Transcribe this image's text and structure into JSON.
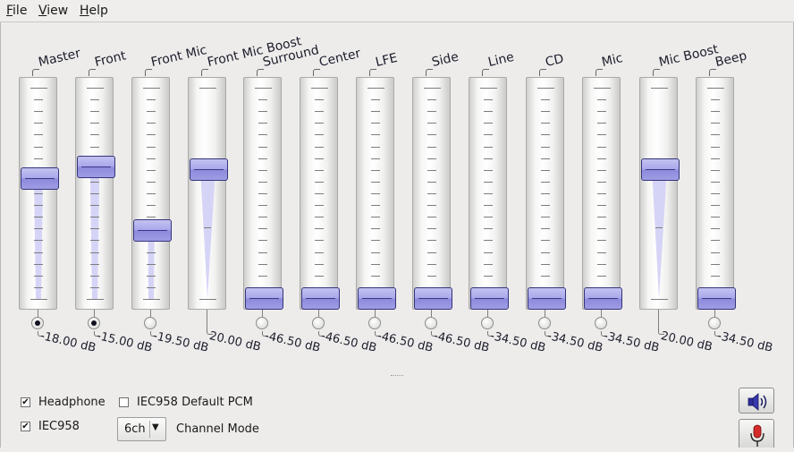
{
  "menu": [
    {
      "label": "File",
      "mnemonic": "F",
      "rest": "ile"
    },
    {
      "label": "View",
      "mnemonic": "V",
      "rest": "iew"
    },
    {
      "label": "Help",
      "mnemonic": "H",
      "rest": "elp"
    }
  ],
  "channels": [
    {
      "name": "Master",
      "volume_db": "-18.00 dB",
      "level": 0.6,
      "record": true
    },
    {
      "name": "Front",
      "volume_db": "-15.00 dB",
      "level": 0.655,
      "record": true
    },
    {
      "name": "Front Mic",
      "volume_db": "-19.50 dB",
      "level": 0.34,
      "record": false
    },
    {
      "name": "Front Mic Boost",
      "volume_db": "20.00 dB",
      "level": 0.645,
      "record": null
    },
    {
      "name": "Surround",
      "volume_db": "-46.50 dB",
      "level": 0.0,
      "record": false
    },
    {
      "name": "Center",
      "volume_db": "-46.50 dB",
      "level": 0.0,
      "record": false
    },
    {
      "name": "LFE",
      "volume_db": "-46.50 dB",
      "level": 0.0,
      "record": false
    },
    {
      "name": "Side",
      "volume_db": "-46.50 dB",
      "level": 0.0,
      "record": false
    },
    {
      "name": "Line",
      "volume_db": "-34.50 dB",
      "level": 0.0,
      "record": false
    },
    {
      "name": "CD",
      "volume_db": "-34.50 dB",
      "level": 0.0,
      "record": false
    },
    {
      "name": "Mic",
      "volume_db": "-34.50 dB",
      "level": 0.0,
      "record": false
    },
    {
      "name": "Mic Boost",
      "volume_db": "20.00 dB",
      "level": 0.645,
      "record": null
    },
    {
      "name": "Beep",
      "volume_db": "-34.50 dB",
      "level": 0.0,
      "record": false
    }
  ],
  "switches": {
    "headphone": {
      "label": "Headphone",
      "checked": true
    },
    "iec958_default_pcm": {
      "label": "IEC958 Default PCM",
      "checked": false
    },
    "iec958": {
      "label": "IEC958",
      "checked": true
    }
  },
  "channel_mode": {
    "value": "6ch",
    "label": "Channel Mode"
  },
  "icons": {
    "playback": "speaker-icon",
    "capture": "microphone-icon"
  },
  "colors": {
    "accent": "#a9a7ea",
    "thumb_border": "#34347a",
    "fill": "#d6d4f6"
  }
}
